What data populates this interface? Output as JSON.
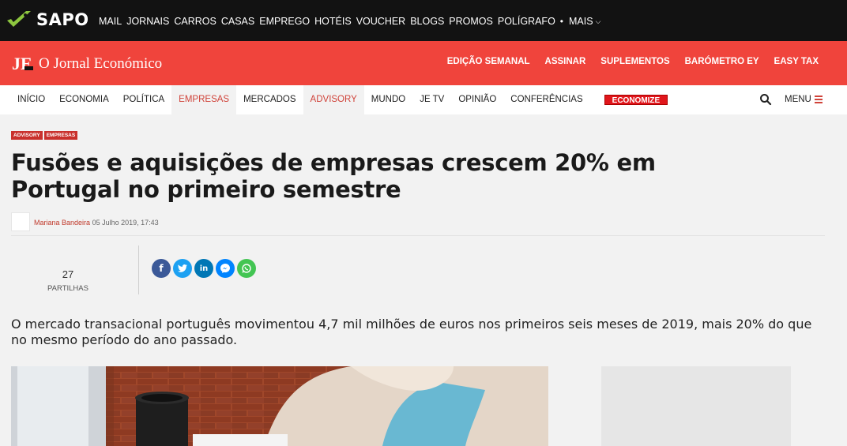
{
  "sapo": {
    "brand": "SAPO",
    "links": [
      "MAIL",
      "JORNAIS",
      "CARROS",
      "CASAS",
      "EMPREGO",
      "HOTÉIS",
      "VOUCHER",
      "BLOGS",
      "PROMOS",
      "POLÍGRAFO"
    ],
    "more": "MAIS",
    "colors": {
      "bar": "#121212",
      "logo": "#8dc63f"
    }
  },
  "je": {
    "monogram": "JE",
    "name": "O Jornal Económico",
    "links": [
      "EDIÇÃO SEMANAL",
      "ASSINAR",
      "SUPLEMENTOS",
      "BARÓMETRO EY",
      "EASY TAX"
    ],
    "colors": {
      "bar": "#f0443c"
    }
  },
  "nav": {
    "items": [
      {
        "label": "INÍCIO",
        "active": false
      },
      {
        "label": "ECONOMIA",
        "active": false
      },
      {
        "label": "POLÍTICA",
        "active": false
      },
      {
        "label": "EMPRESAS",
        "active": true
      },
      {
        "label": "MERCADOS",
        "active": false
      },
      {
        "label": "ADVISORY",
        "active": true
      },
      {
        "label": "MUNDO",
        "active": false
      },
      {
        "label": "JE TV",
        "active": false
      },
      {
        "label": "OPINIÃO",
        "active": false
      },
      {
        "label": "CONFERÊNCIAS",
        "active": false
      }
    ],
    "badge": "ECONOMIZE",
    "search_icon": "search-icon",
    "menu_label": "MENU"
  },
  "article": {
    "tags": [
      "ADVISORY",
      "EMPRESAS"
    ],
    "title": "Fusões e aquisições de empresas crescem 20% em Portugal no primeiro semestre",
    "author": "Mariana Bandeira",
    "date": "05 Julho 2019, 17:43",
    "shares": {
      "count": "27",
      "label": "PARTILHAS"
    },
    "social": [
      {
        "icon": "facebook-icon",
        "glyph": "f",
        "color": "#3b5998"
      },
      {
        "icon": "twitter-icon",
        "glyph": "t",
        "color": "#1da1f2"
      },
      {
        "icon": "linkedin-icon",
        "glyph": "in",
        "color": "#0077b5"
      },
      {
        "icon": "messenger-icon",
        "glyph": "m",
        "color": "#0084ff"
      },
      {
        "icon": "whatsapp-icon",
        "glyph": "w",
        "color": "#43c553"
      }
    ],
    "lead": "O mercado transacional português movimentou 4,7 mil milhões de euros nos primeiros seis meses de 2019, mais 20% do que no mesmo período do ano passado."
  }
}
